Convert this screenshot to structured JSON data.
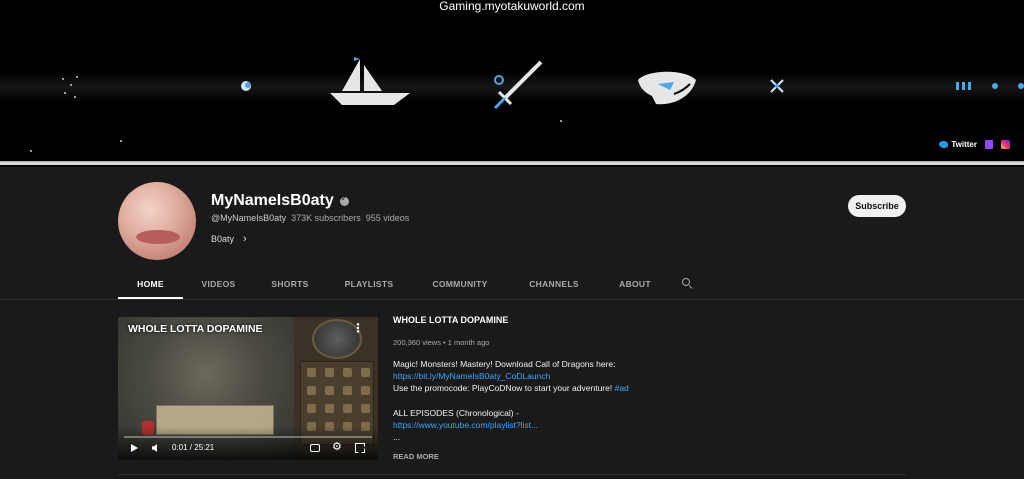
{
  "watermark": "Gaming.myotakuworld.com",
  "banner": {
    "icons": [
      "sailboat-icon",
      "sword-icon",
      "whale-icon",
      "sparkle-icon"
    ],
    "socials": [
      {
        "label": "Twitter",
        "icon": "twitter-icon"
      },
      {
        "label": "",
        "icon": "twitch-icon"
      },
      {
        "label": "",
        "icon": "instagram-icon"
      }
    ]
  },
  "channel": {
    "name": "MyNameIsB0aty",
    "handle": "@MyNameIsB0aty",
    "subscribers": "373K subscribers",
    "videos": "955 videos",
    "link_label": "B0aty",
    "subscribe_label": "Subscribe"
  },
  "tabs": [
    "HOME",
    "VIDEOS",
    "SHORTS",
    "PLAYLISTS",
    "COMMUNITY",
    "CHANNELS",
    "ABOUT"
  ],
  "active_tab": "HOME",
  "featured": {
    "player_title": "WHOLE LOTTA DOPAMINE",
    "time": "0:01 / 25:21",
    "title": "WHOLE LOTTA DOPAMINE",
    "meta": "200,360 views • 1 month ago",
    "desc_line1": "Magic! Monsters! Mastery! Download Call of Dragons here:",
    "desc_link1": "https://bit.ly/MyNameIsB0aty_CoDLaunch",
    "desc_line3": "Use the promocode: PlayCoDNow to start your adventure!",
    "desc_hashtag": "#ad",
    "desc_line4": "ALL EPISODES (Chronological) -",
    "desc_link2": "https://www.youtube.com/playlist?list...",
    "desc_ellipsis": "...",
    "read_more": "READ MORE"
  },
  "colors": {
    "background": "#1a1a1a",
    "link": "#3ea6ff",
    "subscribe_bg": "#f1f1f1"
  }
}
